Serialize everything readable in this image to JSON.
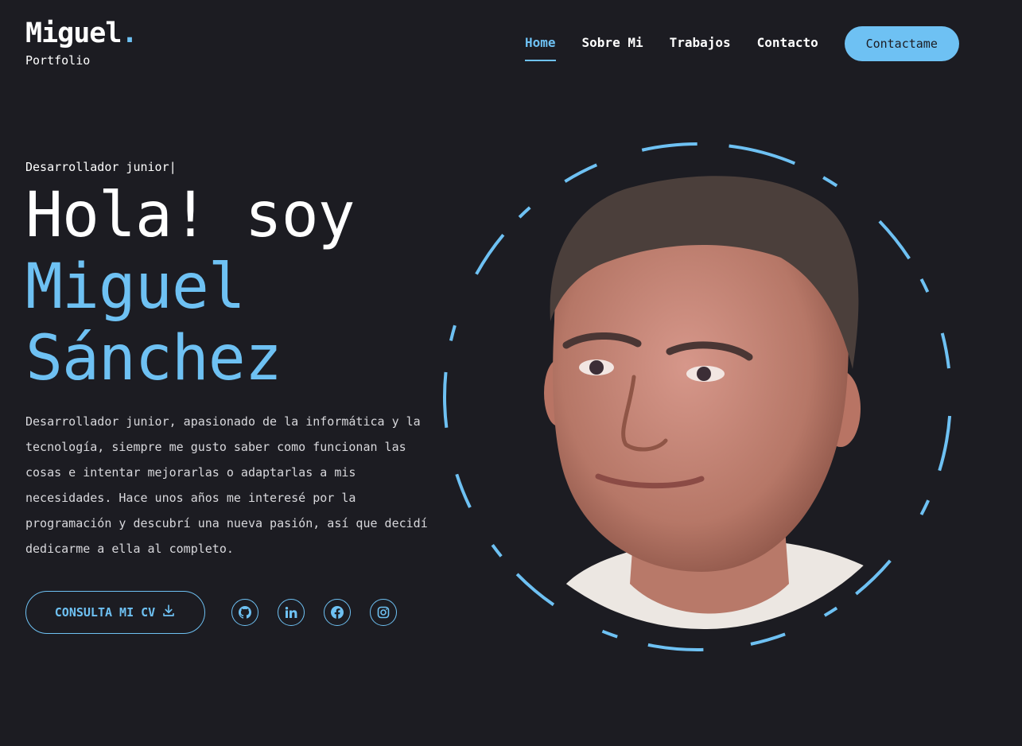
{
  "header": {
    "logo_name": "Miguel",
    "logo_dot": ".",
    "logo_sub": "Portfolio",
    "nav": [
      {
        "label": "Home",
        "active": true
      },
      {
        "label": "Sobre Mi",
        "active": false
      },
      {
        "label": "Trabajos",
        "active": false
      },
      {
        "label": "Contacto",
        "active": false
      }
    ],
    "contact_button": "Contactame"
  },
  "hero": {
    "role": "Desarrollador junior|",
    "greeting": "Hola! soy",
    "name_line1": "Miguel",
    "name_line2": "Sánchez",
    "description": "Desarrollador junior, apasionado de la informática y la tecnología, siempre me gusto saber como funcionan las cosas e intentar mejorarlas o adaptarlas a mis necesidades. Hace unos años me interesé por la programación y descubrí una nueva pasión, así que decidí dedicarme a ella al completo.",
    "cv_button": "CONSULTA MI CV"
  },
  "socials": [
    {
      "icon": "github-icon"
    },
    {
      "icon": "linkedin-icon"
    },
    {
      "icon": "facebook-icon"
    },
    {
      "icon": "instagram-icon"
    }
  ],
  "colors": {
    "background": "#1c1c22",
    "accent": "#6ec1f3",
    "text": "#ffffff"
  }
}
